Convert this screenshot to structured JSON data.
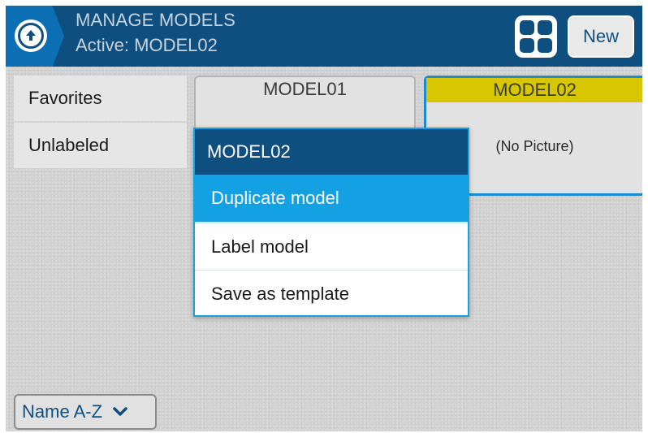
{
  "header": {
    "title": "MANAGE MODELS",
    "subtitle": "Active: MODEL02",
    "new_label": "New"
  },
  "labels": [
    {
      "label": "Favorites"
    },
    {
      "label": "Unlabeled"
    }
  ],
  "models": [
    {
      "name": "MODEL01",
      "picture": ""
    },
    {
      "name": "MODEL02",
      "picture": "(No Picture)"
    }
  ],
  "sort": {
    "selected": "Name A-Z"
  },
  "popup": {
    "title": "MODEL02",
    "items": [
      {
        "label": "Duplicate model"
      },
      {
        "label": "Label model"
      },
      {
        "label": "Save as template"
      }
    ]
  },
  "colors": {
    "header_bg": "#0f4f7f",
    "accent": "#13a1e3",
    "active_model_bar": "#d7c600"
  },
  "icons": {
    "home": "home-circle-icon",
    "grid": "grid-view-icon",
    "sort_toggle": "chevron-down-icon"
  }
}
